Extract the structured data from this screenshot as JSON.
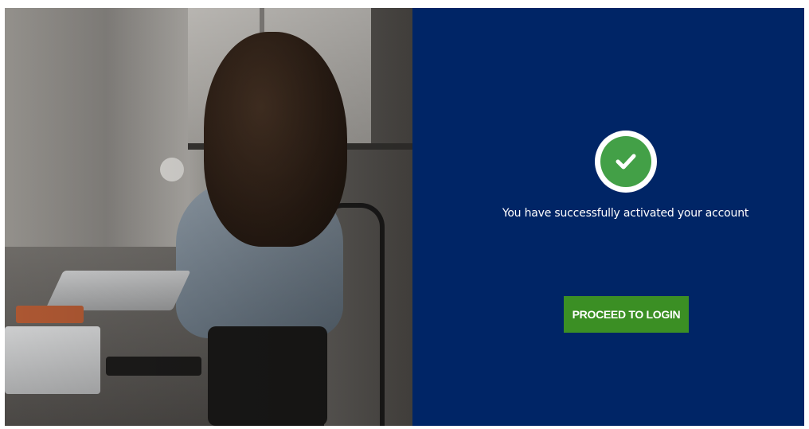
{
  "photo": {
    "description_icon": "person-working-on-laptop-image"
  },
  "panel": {
    "background_color": "#002566",
    "status_icon": "check-circle-icon",
    "status_icon_color": "#43a047",
    "message": "You have successfully activated your account",
    "proceed_button_label": "PROCEED TO LOGIN",
    "proceed_button_color": "#3b8f24"
  }
}
